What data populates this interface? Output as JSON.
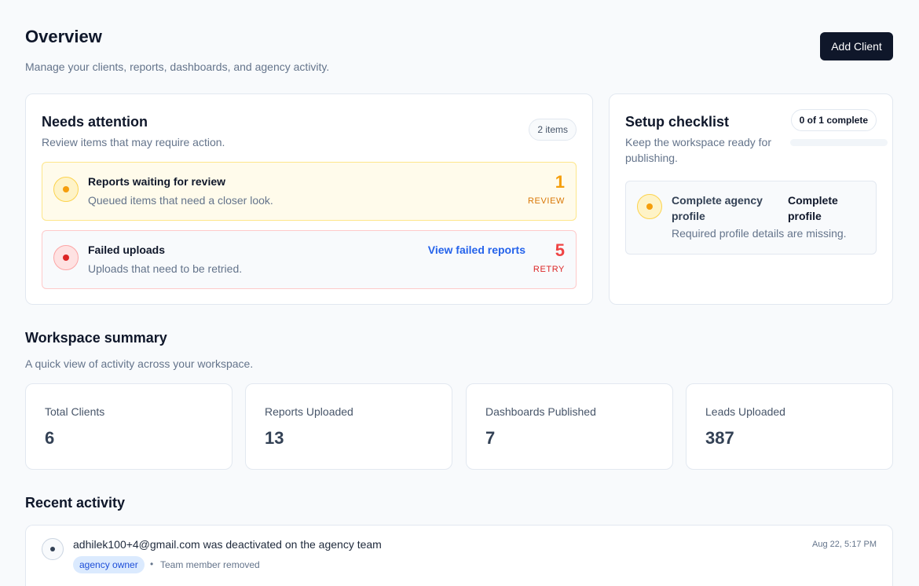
{
  "header": {
    "title": "Overview",
    "subtitle": "Manage your clients, reports, dashboards, and agency activity.",
    "add_button": "Add Client"
  },
  "attention": {
    "title": "Needs attention",
    "description": "Review items that may require action.",
    "count_badge": "2 items",
    "items": [
      {
        "title": "Reports waiting for review",
        "description": "Queued items that need a closer look.",
        "count": "1",
        "tag": "REVIEW"
      },
      {
        "title": "Failed uploads",
        "description": "Uploads that need to be retried.",
        "link": "View failed reports",
        "count": "5",
        "tag": "RETRY"
      }
    ]
  },
  "checklist": {
    "title": "Setup checklist",
    "description": "Keep the workspace ready for publishing.",
    "progress_label": "0 of 1 complete",
    "progress_fraction": 0,
    "tasks": [
      {
        "title": "Complete agency profile",
        "action": "Complete profile",
        "description": "Required profile details are missing."
      }
    ]
  },
  "summary": {
    "title": "Workspace summary",
    "description": "A quick view of activity across your workspace.",
    "stats": [
      {
        "label": "Total Clients",
        "value": "6"
      },
      {
        "label": "Reports Uploaded",
        "value": "13"
      },
      {
        "label": "Dashboards Published",
        "value": "7"
      },
      {
        "label": "Leads Uploaded",
        "value": "387"
      }
    ]
  },
  "activity": {
    "title": "Recent activity",
    "items": [
      {
        "text": "adhilek100+4@gmail.com was deactivated on the agency team",
        "tag": "agency owner",
        "separator": "•",
        "type": "Team member removed",
        "time": "Aug 22, 5:17 PM"
      }
    ]
  },
  "colors": {
    "primary": "#0f172a",
    "warning": "#f59e0b",
    "danger": "#ef4444",
    "link": "#2563eb"
  }
}
